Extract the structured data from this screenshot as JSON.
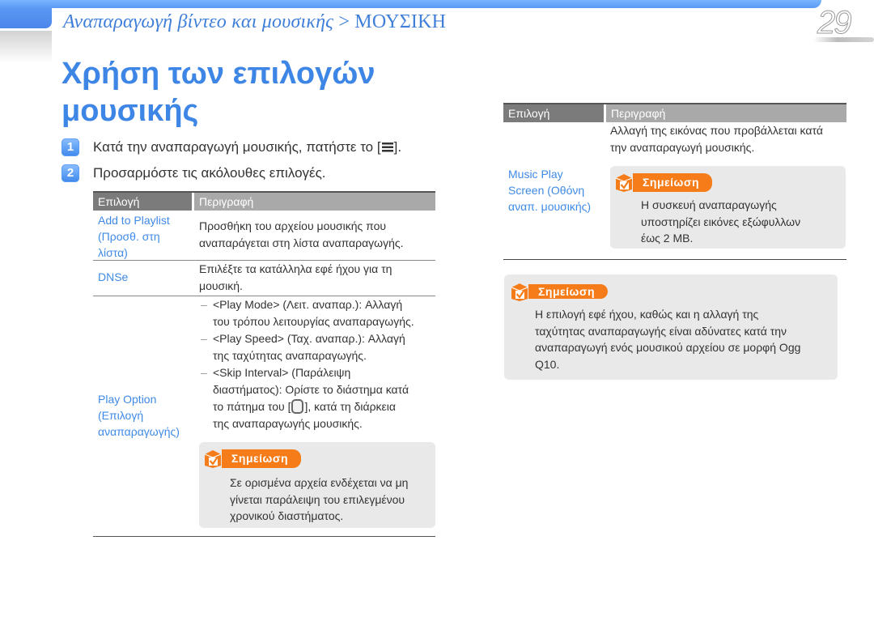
{
  "header": {
    "breadcrumb_part1": "Αναπαραγωγή βίντεο και μουσικής",
    "breadcrumb_sep": ">",
    "breadcrumb_part2": "ΜΟΥΣΙΚΗ",
    "page_number": "29"
  },
  "title": "Χρήση των επιλογών μουσικής",
  "steps": [
    {
      "num": "1",
      "text_before": "Κατά την αναπαραγωγή μουσικής, πατήστε το [",
      "icon": "menu-icon",
      "text_after": "]."
    },
    {
      "num": "2",
      "text": "Προσαρμόστε τις ακόλουθες επιλογές."
    }
  ],
  "table_left": {
    "headers": {
      "option": "Επιλογή",
      "description": "Περιγραφή"
    },
    "rows": [
      {
        "option": [
          "Add to Playlist",
          "(Προσθ. στη",
          "λίστα)"
        ],
        "description": [
          "Προσθήκη του αρχείου μουσικής που",
          "αναπαράγεται στη λίστα αναπαραγωγής."
        ]
      },
      {
        "option": [
          "DNSe"
        ],
        "description": [
          "Επιλέξτε τα κατάλληλα εφέ ήχου για τη",
          "μουσική."
        ]
      },
      {
        "option": [
          "Play Option",
          "(Επιλογή",
          "αναπαραγωγής)"
        ],
        "bullets": [
          {
            "dash": "–",
            "lines": [
              "<Play Mode> (Λειτ. αναπαρ.): Αλλαγή",
              "του τρόπου λειτουργίας αναπαραγωγής."
            ]
          },
          {
            "dash": "–",
            "lines": [
              "<Play Speed> (Ταχ. αναπαρ.): Αλλαγή",
              "της ταχύτητας αναπαραγωγής."
            ]
          },
          {
            "dash": "–",
            "lines": [
              "<Skip Interval> (Παράλειψη",
              "διαστήματος): Ορίστε το διάστημα κατά"
            ],
            "line3_before": "το πάτημα του [",
            "line3_icon": "navigation-ring-icon",
            "line3_after": "], κατά τη διάρκεια",
            "line4": "της αναπαραγωγής μουσικής."
          }
        ],
        "note": {
          "label": "Σημείωση",
          "lines": [
            "Σε ορισμένα αρχεία ενδέχεται να μη",
            "γίνεται παράλειψη του επιλεγμένου",
            "χρονικού διαστήματος."
          ]
        }
      }
    ]
  },
  "table_right": {
    "headers": {
      "option": "Επιλογή",
      "description": "Περιγραφή"
    },
    "rows": [
      {
        "option": [
          "Music Play",
          "Screen (Οθόνη",
          "αναπ. μουσικής)"
        ],
        "description": [
          "Αλλαγή της εικόνας που προβάλλεται κατά",
          "την αναπαραγωγή μουσικής."
        ],
        "note": {
          "label": "Σημείωση",
          "lines": [
            "Η συσκευή αναπαραγωγής",
            "υποστηρίζει εικόνες εξώφυλλων",
            "έως 2 MB."
          ]
        }
      }
    ]
  },
  "bottom_note": {
    "label": "Σημείωση",
    "lines": [
      "Η επιλογή εφέ ήχου, καθώς και η αλλαγή της",
      "ταχύτητας αναπαραγωγής είναι αδύνατες κατά την",
      "αναπαραγωγή ενός μουσικού αρχείου σε μορφή Ogg",
      "Q10."
    ]
  },
  "colors": {
    "accent_blue": "#3d86e6",
    "link_blue": "#3f8ae6",
    "note_orange": "#f57c19",
    "note_bg": "#e9e9e9",
    "header_dark_gray": "#7b7b7b",
    "header_light_gray": "#a9a9a9"
  }
}
